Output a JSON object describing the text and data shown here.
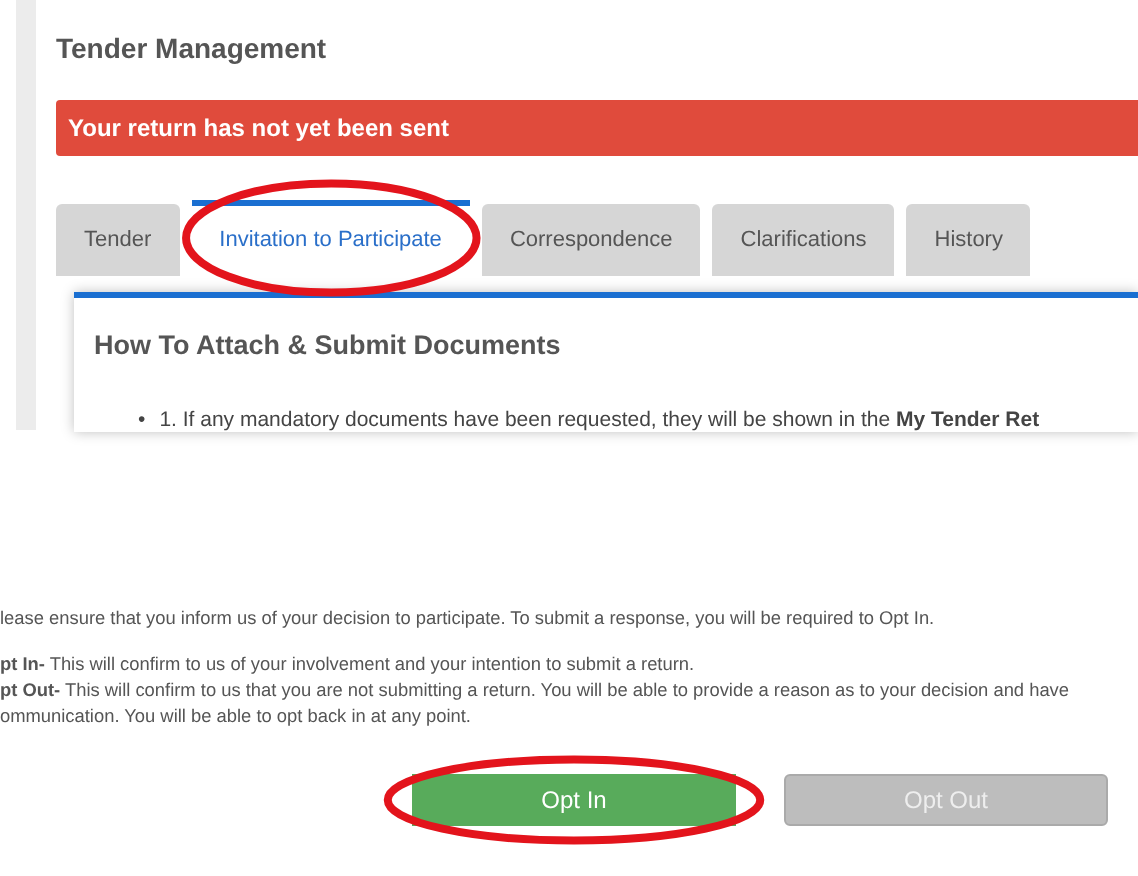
{
  "page_title": "Tender Management",
  "alert": "Your return has not yet been sent",
  "tabs": [
    {
      "label": "Tender",
      "selected": false,
      "highlighted": false
    },
    {
      "label": "Invitation to Participate",
      "selected": true,
      "highlighted": true
    },
    {
      "label": "Correspondence",
      "selected": false,
      "highlighted": false
    },
    {
      "label": "Clarifications",
      "selected": false,
      "highlighted": false
    },
    {
      "label": "History",
      "selected": false,
      "highlighted": false
    }
  ],
  "panel": {
    "heading": "How To Attach & Submit Documents",
    "bullets": [
      {
        "marker": "•",
        "text": "1. If any mandatory documents have been requested, they will be shown in the **My Tender Ret**"
      }
    ]
  },
  "instructions": [
    "lease ensure that you inform us of your decision to participate. To submit a response, you will be required to Opt In.",
    "**pt In-** This will confirm to us of your involvement and your intention to submit a return.",
    "**pt Out-** This will confirm to us that you are not submitting a return. You will be able to provide a reason as to your decision and have",
    "ommunication. You will be able to opt back in at any point."
  ],
  "buttons": [
    {
      "label": "Opt In",
      "kind": "primary",
      "highlighted": true
    },
    {
      "label": "Opt Out",
      "kind": "secondary",
      "highlighted": false
    }
  ]
}
